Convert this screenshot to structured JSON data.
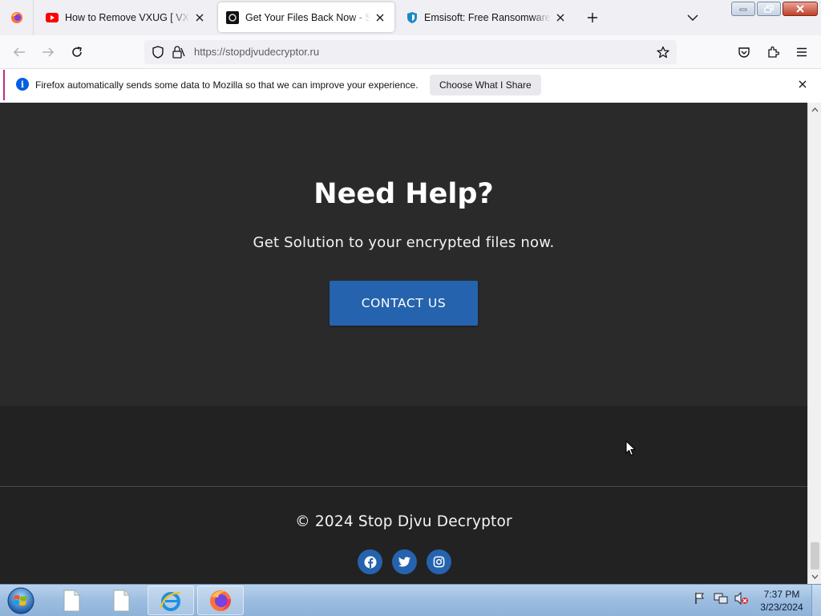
{
  "browser": {
    "tabs": [
      {
        "title": "How to Remove VXUG [ VX-Underground",
        "icon": "youtube-icon",
        "active": false
      },
      {
        "title": "Get Your Files Back Now - Stop Djvu Decryptor",
        "icon": "site-favicon-icon",
        "active": true
      },
      {
        "title": "Emsisoft: Free Ransomware Decryptors",
        "icon": "shield-icon",
        "active": false
      }
    ],
    "url": "https://stopdjvudecryptor.ru"
  },
  "notification": {
    "message": "Firefox automatically sends some data to Mozilla so that we can improve your experience.",
    "button_label": "Choose What I Share"
  },
  "page": {
    "help_title": "Need Help?",
    "help_subtitle": "Get Solution to your encrypted files now.",
    "contact_label": "CONTACT US",
    "copyright": "© 2024 Stop Djvu Decryptor",
    "socials": [
      "facebook-icon",
      "twitter-icon",
      "instagram-icon"
    ]
  },
  "taskbar": {
    "time": "7:37 PM",
    "date": "3/23/2024"
  },
  "colors": {
    "accent": "#2563ae",
    "page_bg": "#2a2a2a",
    "footer_bg": "#222222",
    "notification_border": "#c22886"
  }
}
